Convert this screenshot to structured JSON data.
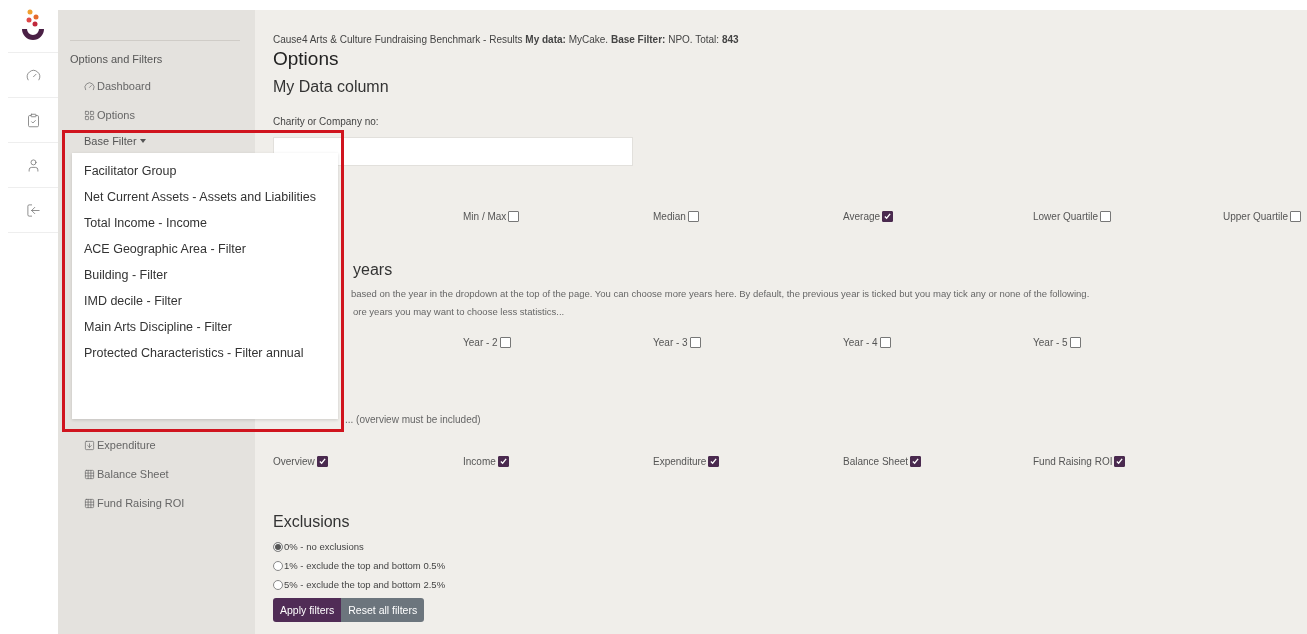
{
  "sidebar": {
    "heading": "Options and Filters",
    "items": [
      {
        "kind": "link",
        "label": "Dashboard"
      },
      {
        "kind": "link",
        "label": "Options"
      },
      {
        "kind": "dropdown",
        "label": "Base Filter",
        "expanded": true,
        "menu": [
          "Facilitator Group",
          "Net Current Assets - Assets and Liabilities",
          "Total Income - Income",
          "ACE Geographic Area - Filter",
          "Building - Filter",
          "IMD decile - Filter",
          "Main Arts Discipline - Filter",
          "Protected Characteristics - Filter annual"
        ]
      },
      {
        "kind": "link",
        "label": "Expenditure"
      },
      {
        "kind": "link",
        "label": "Balance Sheet"
      },
      {
        "kind": "link",
        "label": "Fund Raising ROI"
      }
    ]
  },
  "header": "Cause4 Arts & Culture Fundraising Benchmark - Results **My data:** MyCake. **Base Filter:** NPO. Total: **843**",
  "title": "Options",
  "my_data": {
    "heading": "My Data column",
    "field_label": "Charity or Company no:"
  },
  "statistics": [
    {
      "label": "Min / Max",
      "checked": false
    },
    {
      "label": "Median",
      "checked": false
    },
    {
      "label": "Average",
      "checked": true
    },
    {
      "label": "Lower Quartile",
      "checked": false
    },
    {
      "label": "Upper Quartile",
      "checked": false
    }
  ],
  "years": {
    "heading": "years",
    "description": [
      "based on the year in the dropdown at the top of the page. You can choose more years here. By default, the previous year is ticked but you may tick any or none of the following.",
      "ore years you may want to choose less statistics..."
    ],
    "options": [
      {
        "label": "Year - 2",
        "checked": false
      },
      {
        "label": "Year - 3",
        "checked": false
      },
      {
        "label": "Year - 4",
        "checked": false
      },
      {
        "label": "Year - 5",
        "checked": false
      }
    ]
  },
  "sections": {
    "note": "... (overview must be included)",
    "options": [
      {
        "label": "Overview",
        "checked": true
      },
      {
        "label": "Income",
        "checked": true
      },
      {
        "label": "Expenditure",
        "checked": true
      },
      {
        "label": "Balance Sheet",
        "checked": true
      },
      {
        "label": "Fund Raising ROI",
        "checked": true
      }
    ]
  },
  "exclusions": {
    "heading": "Exclusions",
    "options": [
      {
        "label": "0% - no exclusions",
        "selected": true
      },
      {
        "label": "1% - exclude the top and bottom 0.5%",
        "selected": false
      },
      {
        "label": "5% - exclude the top and bottom 2.5%",
        "selected": false
      }
    ]
  },
  "buttons": [
    {
      "kind": "primary",
      "label": "Apply filters"
    },
    {
      "kind": "secondary",
      "label": "Reset all filters"
    }
  ]
}
